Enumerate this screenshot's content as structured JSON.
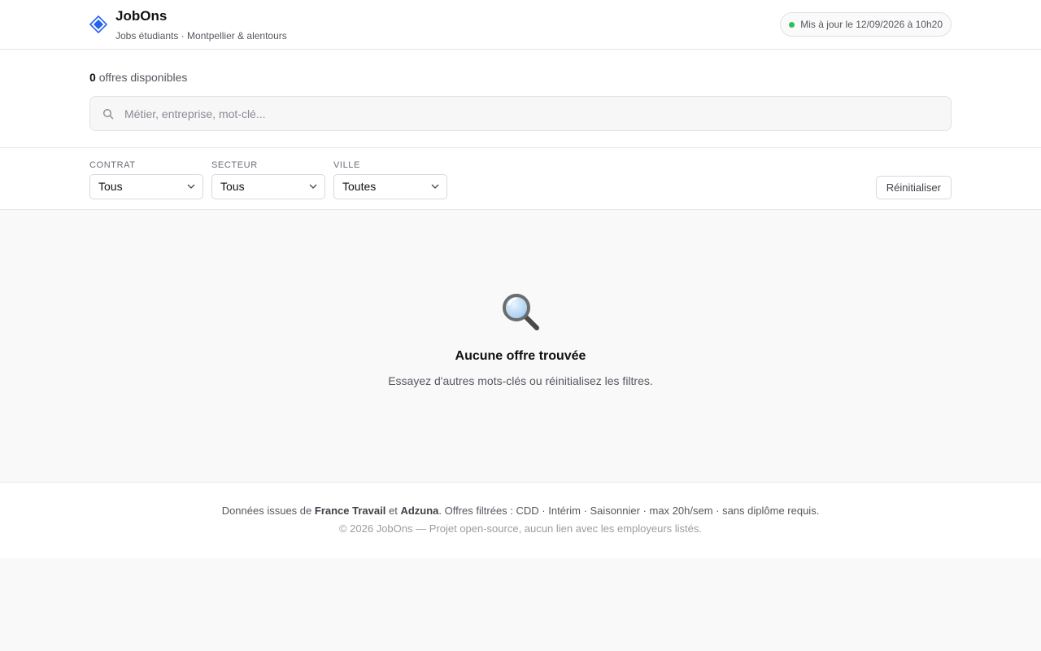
{
  "header": {
    "brand": "JobOns",
    "tagline": "Jobs étudiants · Montpellier & alentours",
    "update_status": "Mis à jour le 12/09/2026 à 10h20",
    "logo_icon": "diamond-logo-icon",
    "status_dot_color": "#2fbf5d",
    "accent_color": "#2563eb"
  },
  "search": {
    "count": "0",
    "count_suffix": "offres disponibles",
    "placeholder": "Métier, entreprise, mot-clé...",
    "value": ""
  },
  "filters": {
    "contract": {
      "label": "Contrat",
      "value": "Tous"
    },
    "sector": {
      "label": "Secteur",
      "value": "Tous"
    },
    "city": {
      "label": "Ville",
      "value": "Toutes"
    },
    "reset_label": "Réinitialiser"
  },
  "empty_state": {
    "icon": "magnifier-icon",
    "title": "Aucune offre trouvée",
    "text": "Essayez d'autres mots-clés ou réinitialisez les filtres."
  },
  "footer": {
    "prefix": "Données issues de",
    "source1": "France Travail",
    "conjunction": "et",
    "source2": "Adzuna",
    "suffix": ". Offres filtrées : CDD · Intérim · Saisonnier · max 20h/sem · sans diplôme requis.",
    "copyright": "© 2026 JobOns — Projet open-source, aucun lien avec les employeurs listés."
  }
}
